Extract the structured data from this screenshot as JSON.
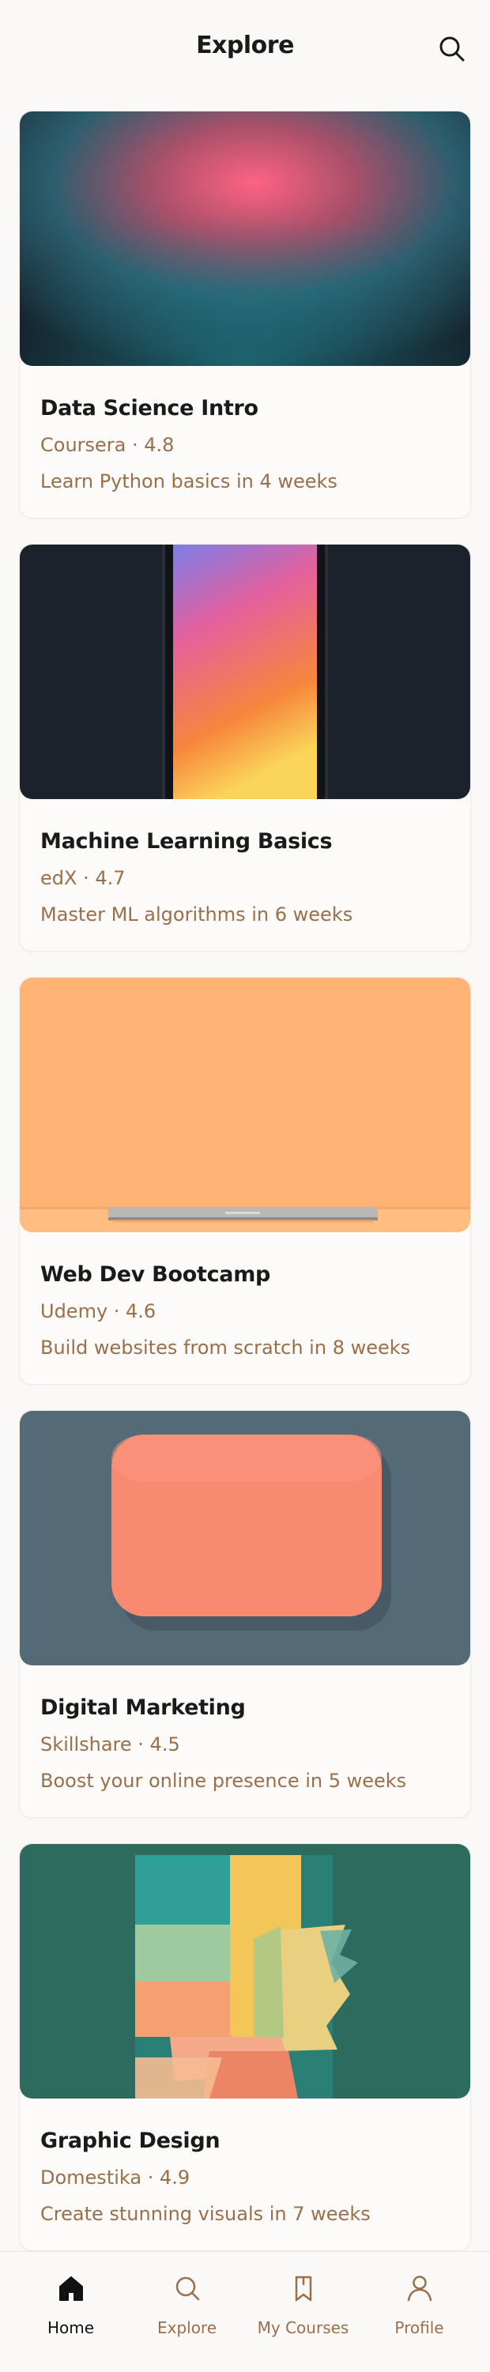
{
  "header": {
    "title": "Explore",
    "search_icon": "search-icon"
  },
  "courses": [
    {
      "title": "Data Science Intro",
      "meta": "Coursera · 4.8",
      "desc": "Learn Python basics in 4 weeks",
      "thumbnail": "pink-teal-gradient"
    },
    {
      "title": "Machine Learning Basics",
      "meta": "edX · 4.7",
      "desc": "Master ML algorithms in 6 weeks",
      "thumbnail": "phone-gradient-screen"
    },
    {
      "title": "Web Dev Bootcamp",
      "meta": "Udemy · 4.6",
      "desc": "Build websites from scratch in 8 weeks",
      "thumbnail": "laptop-on-orange"
    },
    {
      "title": "Digital Marketing",
      "meta": "Skillshare · 4.5",
      "desc": "Boost your online presence in 5 weeks",
      "thumbnail": "coral-rounded-square"
    },
    {
      "title": "Graphic Design",
      "meta": "Domestika · 4.9",
      "desc": "Create stunning visuals in 7 weeks",
      "thumbnail": "abstract-paper-collage"
    }
  ],
  "tabbar": {
    "active": "Home",
    "items": [
      {
        "label": "Home",
        "icon": "home-icon"
      },
      {
        "label": "Explore",
        "icon": "search-icon"
      },
      {
        "label": "My Courses",
        "icon": "bookmark-icon"
      },
      {
        "label": "Profile",
        "icon": "user-icon"
      }
    ]
  },
  "colors": {
    "accent": "#9a6f4a",
    "background": "#fbf9f7",
    "text": "#1a1a1a"
  }
}
